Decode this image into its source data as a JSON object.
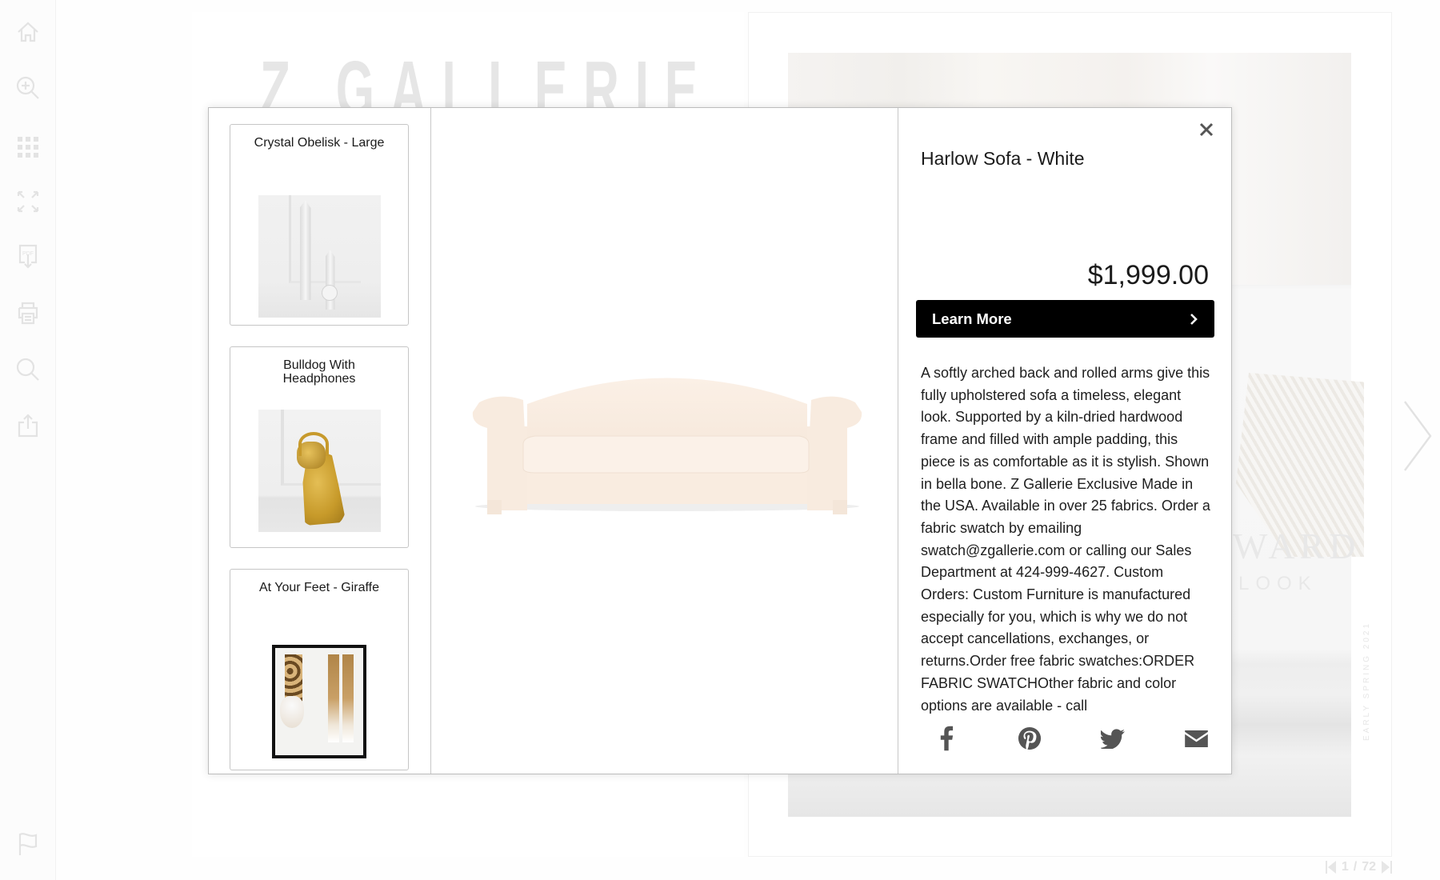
{
  "toolbar": {
    "items": [
      {
        "name": "home",
        "icon": "home-icon"
      },
      {
        "name": "zoom-in",
        "icon": "zoom-in-icon"
      },
      {
        "name": "thumbnails",
        "icon": "grid-icon"
      },
      {
        "name": "fullscreen",
        "icon": "expand-icon"
      },
      {
        "name": "download-pdf",
        "icon": "pdf-download-icon",
        "label": "PDF"
      },
      {
        "name": "print",
        "icon": "printer-icon"
      },
      {
        "name": "search",
        "icon": "search-icon"
      },
      {
        "name": "share",
        "icon": "share-icon"
      }
    ],
    "bottom_item": {
      "name": "flag",
      "icon": "flag-icon"
    }
  },
  "background": {
    "logo_text": "Z GALLERIE",
    "page_words": [
      "WARD",
      "LOOK"
    ],
    "vertical_caption": "EARLY SPRING 2021",
    "pager": {
      "current": "1",
      "separator": "/",
      "total": "72"
    }
  },
  "modal": {
    "related_products": [
      {
        "title": "Crystal Obelisk - Large",
        "image": "crystal-obelisk"
      },
      {
        "title": "Bulldog With Headphones",
        "image": "gold-bulldog-headphones"
      },
      {
        "title": "At Your Feet - Giraffe",
        "image": "giraffe-framed-print"
      }
    ],
    "product": {
      "title": "Harlow Sofa - White",
      "price": "$1,999.00",
      "cta_label": "Learn More",
      "description": "A softly arched back and rolled arms give this fully upholstered sofa a timeless, elegant look. Supported by a kiln-dried hardwood frame and filled with ample padding, this piece is as comfortable as it is stylish. Shown in bella bone. Z Gallerie Exclusive Made in the USA.  Available in over 25 fabrics. Order a fabric swatch by emailing swatch@zgallerie.com or calling our Sales Department at 424-999-4627. Custom Orders: Custom Furniture is manufactured especially for you, which is why we do not accept cancellations, exchanges, or returns.Order free fabric swatches:ORDER FABRIC SWATCHOther fabric and color options are available - call",
      "sofa_color": "#f9ece0"
    },
    "share": [
      "facebook",
      "pinterest",
      "twitter",
      "email"
    ],
    "close_label": "×"
  },
  "colors": {
    "cta_bg": "#000000",
    "icon_gray": "#555555"
  }
}
